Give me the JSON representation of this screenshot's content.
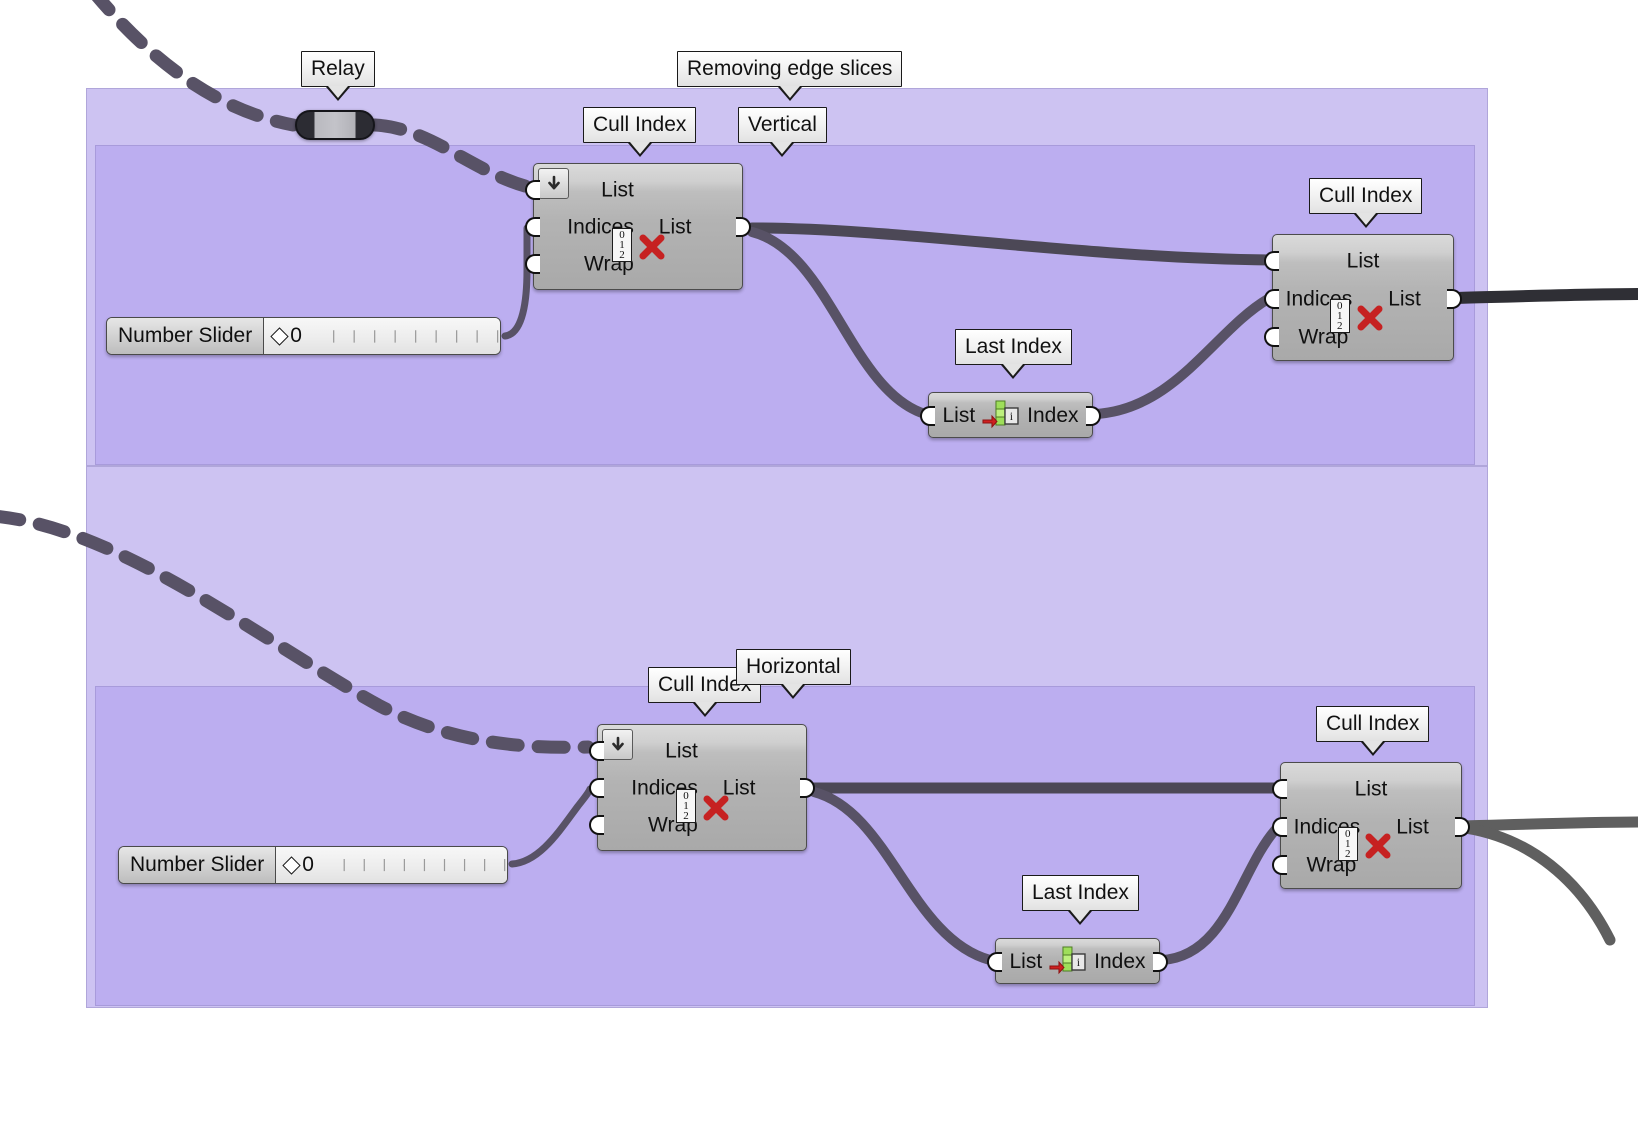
{
  "canvas": {
    "background": "#ffffff",
    "group_outer_color": "#cdc3f2",
    "group_inner_color": "#bcaef0",
    "wire_color": "#585266",
    "wire_color_light": "#6b6b6b"
  },
  "labels": {
    "relay": "Relay",
    "removing_edge_slices": "Removing edge slices",
    "cull_index_top_left": "Cull Index",
    "vertical": "Vertical",
    "cull_index_top_right": "Cull Index",
    "last_index_top": "Last Index",
    "cull_index_bottom_left": "Cull Index",
    "horizontal": "Horizontal",
    "cull_index_bottom_right": "Cull Index",
    "last_index_bottom": "Last Index"
  },
  "components": {
    "cull_index": {
      "inputs": [
        "List",
        "Indices",
        "Wrap"
      ],
      "outputs": [
        "List"
      ],
      "icon": "cull-index-icon",
      "icon_digits": [
        "0",
        "1",
        "2"
      ]
    },
    "last_index": {
      "inputs": [
        "List"
      ],
      "outputs": [
        "Index"
      ],
      "icon": "last-index-icon"
    },
    "relay": {
      "icon": "relay-pill-icon"
    }
  },
  "sliders": [
    {
      "name": "Number Slider",
      "value": "0",
      "tick_count": 9,
      "handle": "diamond-handle"
    },
    {
      "name": "Number Slider",
      "value": "0",
      "tick_count": 9,
      "handle": "diamond-handle"
    }
  ]
}
